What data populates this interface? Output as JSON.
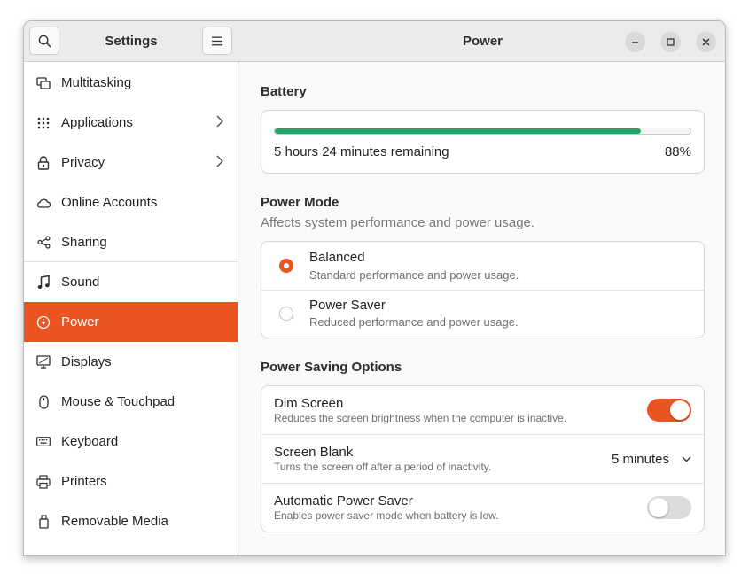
{
  "sidebar": {
    "title": "Settings",
    "items": [
      {
        "label": "Multitasking",
        "icon": "multitasking-icon"
      },
      {
        "label": "Applications",
        "icon": "applications-icon"
      },
      {
        "label": "Privacy",
        "icon": "privacy-icon"
      },
      {
        "label": "Online Accounts",
        "icon": "cloud-icon"
      },
      {
        "label": "Sharing",
        "icon": "sharing-icon"
      },
      {
        "label": "Sound",
        "icon": "music-note-icon"
      },
      {
        "label": "Power",
        "icon": "power-icon"
      },
      {
        "label": "Displays",
        "icon": "display-icon"
      },
      {
        "label": "Mouse & Touchpad",
        "icon": "mouse-icon"
      },
      {
        "label": "Keyboard",
        "icon": "keyboard-icon"
      },
      {
        "label": "Printers",
        "icon": "printer-icon"
      },
      {
        "label": "Removable Media",
        "icon": "removable-media-icon"
      }
    ],
    "active_item": "Power"
  },
  "header": {
    "title": "Power"
  },
  "battery": {
    "section_title": "Battery",
    "remaining_text": "5 hours 24 minutes remaining",
    "percent_text": "88%",
    "level": 0.88
  },
  "power_mode": {
    "section_title": "Power Mode",
    "section_subtitle": "Affects system performance and power usage.",
    "options": [
      {
        "title": "Balanced",
        "subtitle": "Standard performance and power usage.",
        "selected": true
      },
      {
        "title": "Power Saver",
        "subtitle": "Reduced performance and power usage.",
        "selected": false
      }
    ]
  },
  "power_saving": {
    "section_title": "Power Saving Options",
    "dim_screen": {
      "title": "Dim Screen",
      "subtitle": "Reduces the screen brightness when the computer is inactive.",
      "enabled": true
    },
    "screen_blank": {
      "title": "Screen Blank",
      "subtitle": "Turns the screen off after a period of inactivity.",
      "value": "5 minutes"
    },
    "auto_power_saver": {
      "title": "Automatic Power Saver",
      "subtitle": "Enables power saver mode when battery is low.",
      "enabled": false
    }
  },
  "colors": {
    "accent": "#e95420",
    "battery_fill": "#26a269"
  }
}
